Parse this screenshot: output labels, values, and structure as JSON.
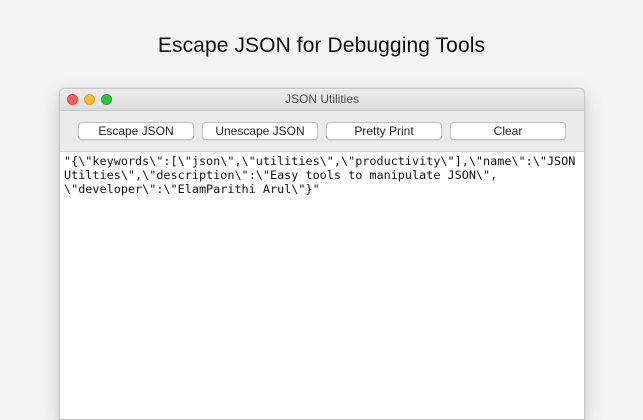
{
  "page": {
    "headline": "Escape JSON for Debugging Tools"
  },
  "window": {
    "title": "JSON Utilities",
    "controls": {
      "close": "close",
      "minimize": "minimize",
      "zoom": "zoom"
    }
  },
  "toolbar": {
    "buttons": [
      {
        "label": "Escape JSON"
      },
      {
        "label": "Unescape JSON"
      },
      {
        "label": "Pretty Print"
      },
      {
        "label": "Clear"
      }
    ]
  },
  "editor": {
    "lines": [
      "\"{\\\"keywords\\\":[\\\"json\\\",\\\"utilities\\\",\\\"productivity\\\"],\\\"name\\\":\\\"JSON",
      "Utilties\\\",\\\"description\\\":\\\"Easy tools to manipulate JSON\\\",",
      "\\\"developer\\\":\\\"ElamParithi Arul\\\"}\""
    ]
  },
  "colors": {
    "close": "#fc5f57",
    "minimize": "#fdbc2e",
    "zoom": "#28c840"
  }
}
